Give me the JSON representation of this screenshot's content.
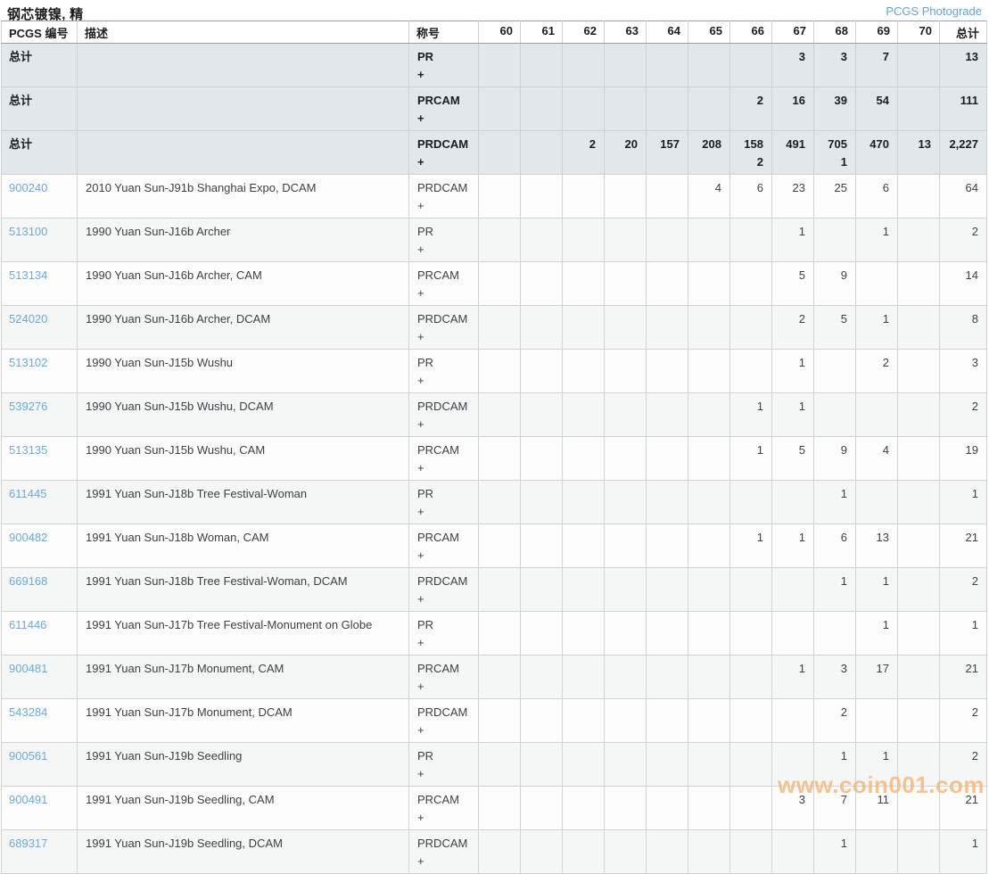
{
  "page": {
    "title": "钢芯镀镍, 精",
    "photograde_link": "PCGS Photograde"
  },
  "colors": {
    "link": "#6aabdf",
    "header_link": "#64a3da",
    "totals_row_bg": "#e1e7ea",
    "watermark": "#f5b87c"
  },
  "watermark": "www.coin001.com",
  "table": {
    "headers": {
      "id": "PCGS 编号",
      "desc": "描述",
      "designation": "称号",
      "total": "总计"
    },
    "grade_keys": [
      "60",
      "61",
      "62",
      "63",
      "64",
      "65",
      "66",
      "67",
      "68",
      "69",
      "70"
    ],
    "summary_rows": [
      {
        "label": "总计",
        "designation": "PR",
        "plus": "+",
        "grades": {
          "67": "3",
          "68": "3",
          "69": "7"
        },
        "total": "13"
      },
      {
        "label": "总计",
        "designation": "PRCAM",
        "plus": "+",
        "grades": {
          "66": "2",
          "67": "16",
          "68": "39",
          "69": "54"
        },
        "total": "111"
      },
      {
        "label": "总计",
        "designation": "PRDCAM",
        "plus": "+",
        "grades": {
          "62": "2",
          "63": "20",
          "64": "157",
          "65": "208",
          "66": "158\n2",
          "67": "491",
          "68": "705\n1",
          "69": "470",
          "70": "13"
        },
        "total": "2,227"
      }
    ],
    "rows": [
      {
        "id": "900240",
        "desc": "2010 Yuan Sun-J91b Shanghai Expo, DCAM",
        "designation": "PRDCAM",
        "plus": "+",
        "grades": {
          "65": "4",
          "66": "6",
          "67": "23",
          "68": "25",
          "69": "6"
        },
        "total": "64"
      },
      {
        "id": "513100",
        "desc": "1990 Yuan Sun-J16b Archer",
        "designation": "PR",
        "plus": "+",
        "grades": {
          "67": "1",
          "69": "1"
        },
        "total": "2"
      },
      {
        "id": "513134",
        "desc": "1990 Yuan Sun-J16b Archer, CAM",
        "designation": "PRCAM",
        "plus": "+",
        "grades": {
          "67": "5",
          "68": "9"
        },
        "total": "14"
      },
      {
        "id": "524020",
        "desc": "1990 Yuan Sun-J16b Archer, DCAM",
        "designation": "PRDCAM",
        "plus": "+",
        "grades": {
          "67": "2",
          "68": "5",
          "69": "1"
        },
        "total": "8"
      },
      {
        "id": "513102",
        "desc": "1990 Yuan Sun-J15b Wushu",
        "designation": "PR",
        "plus": "+",
        "grades": {
          "67": "1",
          "69": "2"
        },
        "total": "3"
      },
      {
        "id": "539276",
        "desc": "1990 Yuan Sun-J15b Wushu, DCAM",
        "designation": "PRDCAM",
        "plus": "+",
        "grades": {
          "66": "1",
          "67": "1"
        },
        "total": "2"
      },
      {
        "id": "513135",
        "desc": "1990 Yuan Sun-J15b Wushu, CAM",
        "designation": "PRCAM",
        "plus": "+",
        "grades": {
          "66": "1",
          "67": "5",
          "68": "9",
          "69": "4"
        },
        "total": "19"
      },
      {
        "id": "611445",
        "desc": "1991 Yuan Sun-J18b Tree Festival-Woman",
        "designation": "PR",
        "plus": "+",
        "grades": {
          "68": "1"
        },
        "total": "1"
      },
      {
        "id": "900482",
        "desc": "1991 Yuan Sun-J18b Woman, CAM",
        "designation": "PRCAM",
        "plus": "+",
        "grades": {
          "66": "1",
          "67": "1",
          "68": "6",
          "69": "13"
        },
        "total": "21"
      },
      {
        "id": "669168",
        "desc": "1991 Yuan Sun-J18b Tree Festival-Woman, DCAM",
        "designation": "PRDCAM",
        "plus": "+",
        "grades": {
          "68": "1",
          "69": "1"
        },
        "total": "2"
      },
      {
        "id": "611446",
        "desc": "1991 Yuan Sun-J17b Tree Festival-Monument on Globe",
        "designation": "PR",
        "plus": "+",
        "grades": {
          "69": "1"
        },
        "total": "1"
      },
      {
        "id": "900481",
        "desc": "1991 Yuan Sun-J17b Monument, CAM",
        "designation": "PRCAM",
        "plus": "+",
        "grades": {
          "67": "1",
          "68": "3",
          "69": "17"
        },
        "total": "21"
      },
      {
        "id": "543284",
        "desc": "1991 Yuan Sun-J17b Monument, DCAM",
        "designation": "PRDCAM",
        "plus": "+",
        "grades": {
          "68": "2"
        },
        "total": "2"
      },
      {
        "id": "900561",
        "desc": "1991 Yuan Sun-J19b Seedling",
        "designation": "PR",
        "plus": "+",
        "grades": {
          "68": "1",
          "69": "1"
        },
        "total": "2"
      },
      {
        "id": "900491",
        "desc": "1991 Yuan Sun-J19b Seedling, CAM",
        "designation": "PRCAM",
        "plus": "+",
        "grades": {
          "67": "3",
          "68": "7",
          "69": "11"
        },
        "total": "21"
      },
      {
        "id": "689317",
        "desc": "1991 Yuan Sun-J19b Seedling, DCAM",
        "designation": "PRDCAM",
        "plus": "+",
        "grades": {
          "68": "1"
        },
        "total": "1"
      }
    ]
  }
}
